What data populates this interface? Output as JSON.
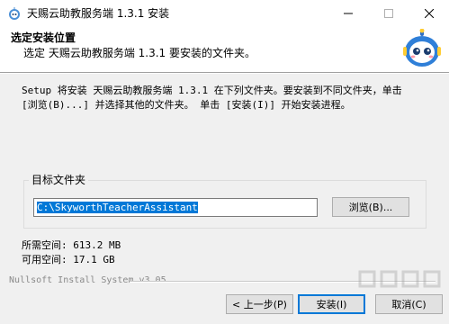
{
  "window": {
    "title": "天赐云助教服务端 1.3.1 安装",
    "icon": "app-robot-icon"
  },
  "header": {
    "title": "选定安装位置",
    "subtitle": "选定 天赐云助教服务端 1.3.1 要安装的文件夹。",
    "logo": "robot-mascot-icon"
  },
  "description": "Setup 将安装 天赐云助教服务端 1.3.1 在下列文件夹。要安装到不同文件夹，单击\n[浏览(B)...] 并选择其他的文件夹。 单击 [安装(I)] 开始安装进程。",
  "destination": {
    "group_label": "目标文件夹",
    "path_value": "C:\\SkyworthTeacherAssistant",
    "browse_label": "浏览(B)..."
  },
  "space": {
    "required": "所需空间: 613.2 MB",
    "available": "可用空间: 17.1 GB"
  },
  "footer": {
    "brand": "Nullsoft Install System v3.05",
    "back_label": "< 上一步(P)",
    "install_label": "安装(I)",
    "cancel_label": "取消(C)"
  },
  "colors": {
    "selection": "#0078d7",
    "button_face": "#e1e1e1",
    "dialog_bg": "#f0f0f0"
  }
}
